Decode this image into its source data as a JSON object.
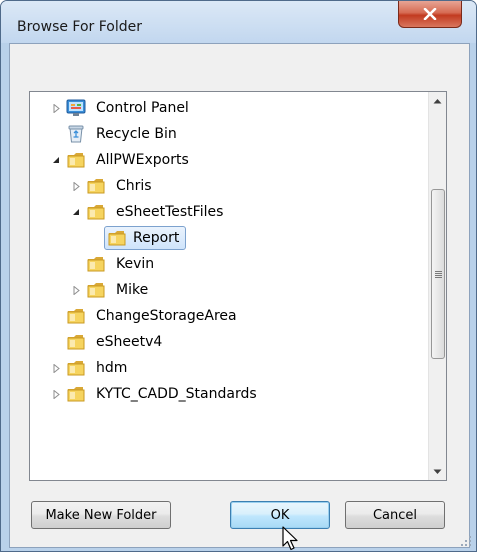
{
  "window": {
    "title": "Browse For Folder",
    "close_icon": "close-icon"
  },
  "tree": {
    "items": [
      {
        "label": "Control Panel",
        "icon": "control-panel-icon",
        "expander": "collapsed"
      },
      {
        "label": "Recycle Bin",
        "icon": "recycle-bin-icon",
        "expander": "none"
      },
      {
        "label": "AllPWExports",
        "icon": "folder-icon",
        "expander": "expanded"
      },
      {
        "label": "Chris",
        "icon": "folder-icon",
        "expander": "collapsed"
      },
      {
        "label": "eSheetTestFiles",
        "icon": "folder-icon",
        "expander": "expanded"
      },
      {
        "label": "Report",
        "icon": "folder-icon",
        "expander": "none",
        "selected": true
      },
      {
        "label": "Kevin",
        "icon": "folder-icon",
        "expander": "none"
      },
      {
        "label": "Mike",
        "icon": "folder-icon",
        "expander": "collapsed"
      },
      {
        "label": "ChangeStorageArea",
        "icon": "folder-icon",
        "expander": "none"
      },
      {
        "label": "eSheetv4",
        "icon": "folder-icon",
        "expander": "none"
      },
      {
        "label": "hdm",
        "icon": "folder-icon",
        "expander": "collapsed"
      },
      {
        "label": "KYTC_CADD_Standards",
        "icon": "folder-icon",
        "expander": "collapsed"
      }
    ]
  },
  "buttons": {
    "make_new_folder": "Make New Folder",
    "ok": "OK",
    "cancel": "Cancel"
  },
  "colors": {
    "selection_border": "#7da2ce",
    "ok_border": "#3c7fb1",
    "close_red": "#c23b20"
  }
}
